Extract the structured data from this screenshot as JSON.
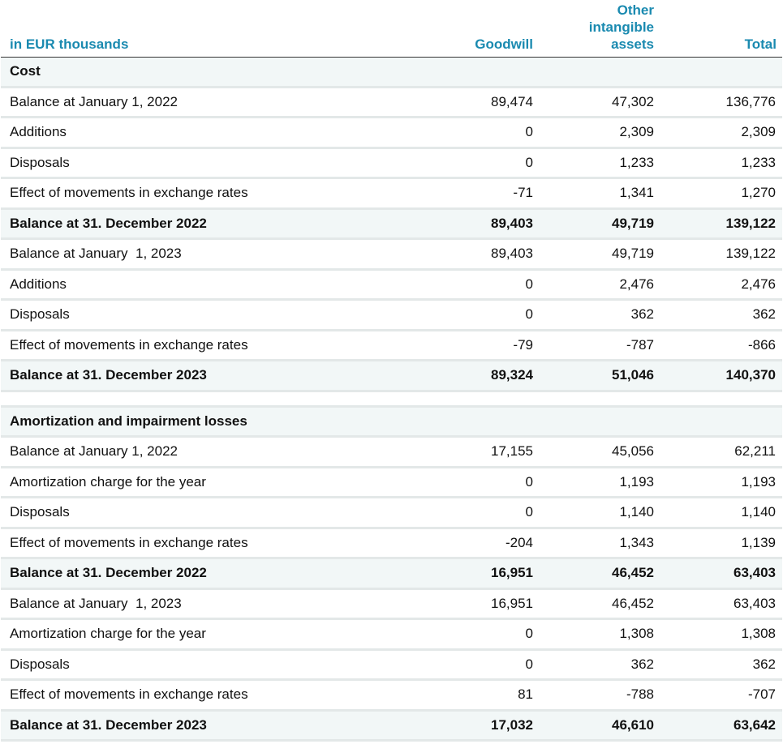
{
  "header": {
    "label": "in EUR thousands",
    "col1": "Goodwill",
    "col2_line1": "Other",
    "col2_line2": "intangible",
    "col2_line3": "assets",
    "col3": "Total"
  },
  "rows": [
    {
      "label": "Cost",
      "v1": "",
      "v2": "",
      "v3": "",
      "bold": true,
      "shaded": true
    },
    {
      "label": "Balance at January 1, 2022",
      "v1": "89,474",
      "v2": "47,302",
      "v3": "136,776"
    },
    {
      "label": "Additions",
      "v1": "0",
      "v2": "2,309",
      "v3": "2,309"
    },
    {
      "label": "Disposals",
      "v1": "0",
      "v2": "1,233",
      "v3": "1,233"
    },
    {
      "label": "Effect of movements in exchange rates",
      "v1": "-71",
      "v2": "1,341",
      "v3": "1,270"
    },
    {
      "label": "Balance at 31. December 2022",
      "v1": "89,403",
      "v2": "49,719",
      "v3": "139,122",
      "bold": true,
      "shaded": true
    },
    {
      "label": "Balance at January  1, 2023",
      "v1": "89,403",
      "v2": "49,719",
      "v3": "139,122"
    },
    {
      "label": "Additions",
      "v1": "0",
      "v2": "2,476",
      "v3": "2,476"
    },
    {
      "label": "Disposals",
      "v1": "0",
      "v2": "362",
      "v3": "362"
    },
    {
      "label": "Effect of movements in exchange rates",
      "v1": "-79",
      "v2": "-787",
      "v3": "-866"
    },
    {
      "label": "Balance at 31. December 2023",
      "v1": "89,324",
      "v2": "51,046",
      "v3": "140,370",
      "bold": true,
      "shaded": true
    },
    {
      "spacer": true
    },
    {
      "label": "Amortization and impairment losses",
      "v1": "",
      "v2": "",
      "v3": "",
      "bold": true,
      "shaded": true
    },
    {
      "label": "Balance at January 1, 2022",
      "v1": "17,155",
      "v2": "45,056",
      "v3": "62,211"
    },
    {
      "label": "Amortization charge for the year",
      "v1": "0",
      "v2": "1,193",
      "v3": "1,193"
    },
    {
      "label": "Disposals",
      "v1": "0",
      "v2": "1,140",
      "v3": "1,140"
    },
    {
      "label": "Effect of movements in exchange rates",
      "v1": "-204",
      "v2": "1,343",
      "v3": "1,139"
    },
    {
      "label": "Balance at 31. December 2022",
      "v1": "16,951",
      "v2": "46,452",
      "v3": "63,403",
      "bold": true,
      "shaded": true
    },
    {
      "label": "Balance at January  1, 2023",
      "v1": "16,951",
      "v2": "46,452",
      "v3": "63,403"
    },
    {
      "label": "Amortization charge for the year",
      "v1": "0",
      "v2": "1,308",
      "v3": "1,308"
    },
    {
      "label": "Disposals",
      "v1": "0",
      "v2": "362",
      "v3": "362"
    },
    {
      "label": "Effect of movements in exchange rates",
      "v1": "81",
      "v2": "-788",
      "v3": "-707"
    },
    {
      "label": "Balance at 31. December 2023",
      "v1": "17,032",
      "v2": "46,610",
      "v3": "63,642",
      "bold": true,
      "shaded": true
    }
  ]
}
